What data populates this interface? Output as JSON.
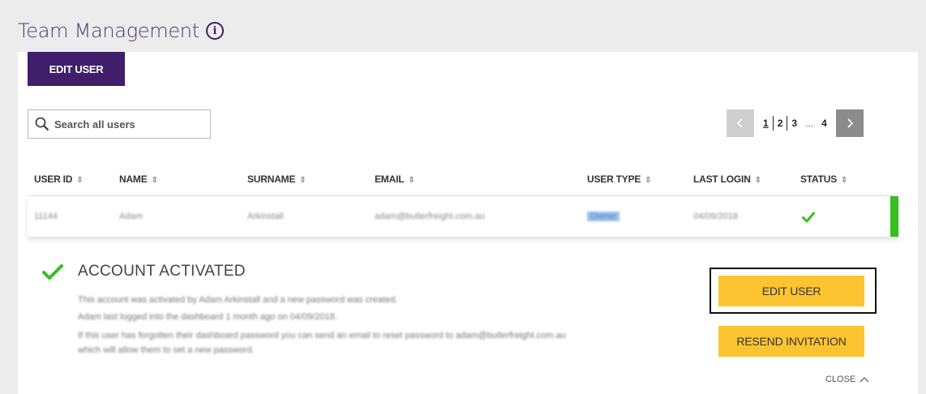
{
  "header": {
    "title": "Team Management",
    "info_icon": "info-icon"
  },
  "toolbar": {
    "edit_user_label": "EDIT USER"
  },
  "search": {
    "placeholder": "Search all users",
    "icon": "search-icon"
  },
  "pagination": {
    "pages": [
      "1",
      "2",
      "3",
      "4"
    ],
    "ellipsis": "...",
    "active": "1",
    "prev_icon": "chevron-left-icon",
    "next_icon": "chevron-right-icon"
  },
  "table": {
    "columns": [
      "USER ID",
      "NAME",
      "SURNAME",
      "EMAIL",
      "USER TYPE",
      "LAST LOGIN",
      "STATUS"
    ],
    "row": {
      "user_id": "11144",
      "name": "Adam",
      "surname": "Arkinstall",
      "email": "adam@butlerfreight.com.au",
      "user_type": "Owner",
      "last_login": "04/09/2018",
      "status_icon": "check-icon"
    }
  },
  "details": {
    "status_title": "ACCOUNT ACTIVATED",
    "lines": [
      "This account was activated by Adam Arkinstall and a new password was created.",
      "Adam last logged into the dashboard 1 month ago on 04/09/2018.",
      "If this user has forgotten their dashboard password you can send an email to reset password to adam@butlerfreight.com.au",
      "which will allow them to set a new password."
    ],
    "edit_label": "EDIT USER",
    "resend_label": "RESEND INVITATION",
    "close_label": "CLOSE"
  },
  "colors": {
    "brand_purple": "#3f1f6b",
    "accent_yellow": "#fcc431",
    "success_green": "#35c01f"
  }
}
